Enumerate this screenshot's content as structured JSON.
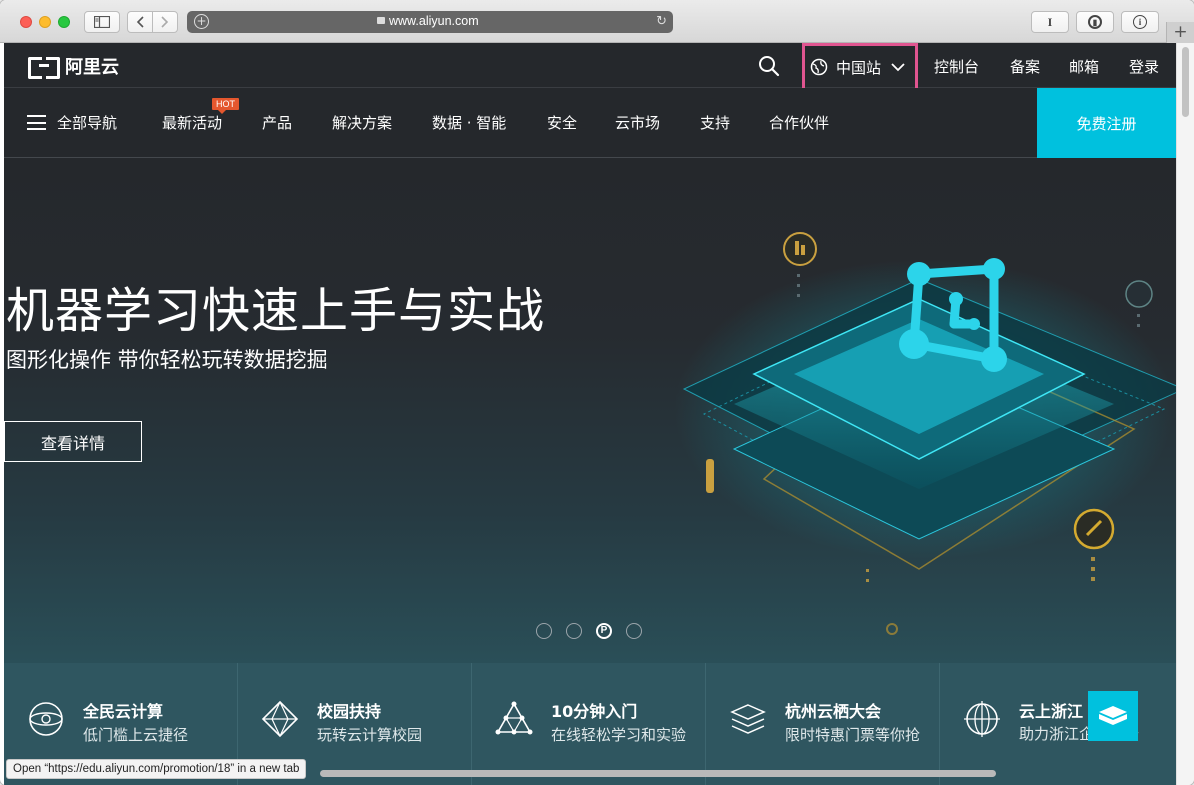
{
  "browser": {
    "url": "www.aliyun.com",
    "reader_label": "I",
    "onepass_label": "⓵",
    "info_label": "i",
    "newtab_label": "+",
    "status_text": "Open “https://edu.aliyun.com/promotion/18” in a new tab"
  },
  "topbar": {
    "logo_text": "阿里云",
    "region_label": "中国站",
    "links": [
      "控制台",
      "备案",
      "邮箱",
      "登录"
    ]
  },
  "nav": {
    "all_nav_label": "全部导航",
    "hot_badge": "HOT",
    "items": [
      "最新活动",
      "产品",
      "解决方案",
      "数据 · 智能",
      "安全",
      "云市场",
      "支持",
      "合作伙伴"
    ],
    "register_label": "免费注册"
  },
  "hero": {
    "title": "机器学习快速上手与实战",
    "subtitle": "图形化操作 带你轻松玩转数据挖掘",
    "button_label": "查看详情",
    "active_dot_label": "P",
    "dot_count": 4,
    "active_dot_index": 2
  },
  "features": [
    {
      "title": "全民云计算",
      "subtitle": "低门槛上云捷径",
      "icon": "globe-icon"
    },
    {
      "title": "校园扶持",
      "subtitle": "玩转云计算校园",
      "icon": "diamond-network-icon"
    },
    {
      "title": "10分钟入门",
      "subtitle": "在线轻松学习和实验",
      "icon": "triangle-network-icon"
    },
    {
      "title": "杭州云栖大会",
      "subtitle": "限时特惠门票等你抢",
      "icon": "layers-icon"
    },
    {
      "title": "云上浙江",
      "subtitle": "助力浙江企业上云",
      "icon": "target-globe-icon"
    }
  ],
  "colors": {
    "accent": "#00c1de",
    "page_bg": "#25282c",
    "hot": "#e4572e",
    "highlight_border": "#e05590"
  }
}
